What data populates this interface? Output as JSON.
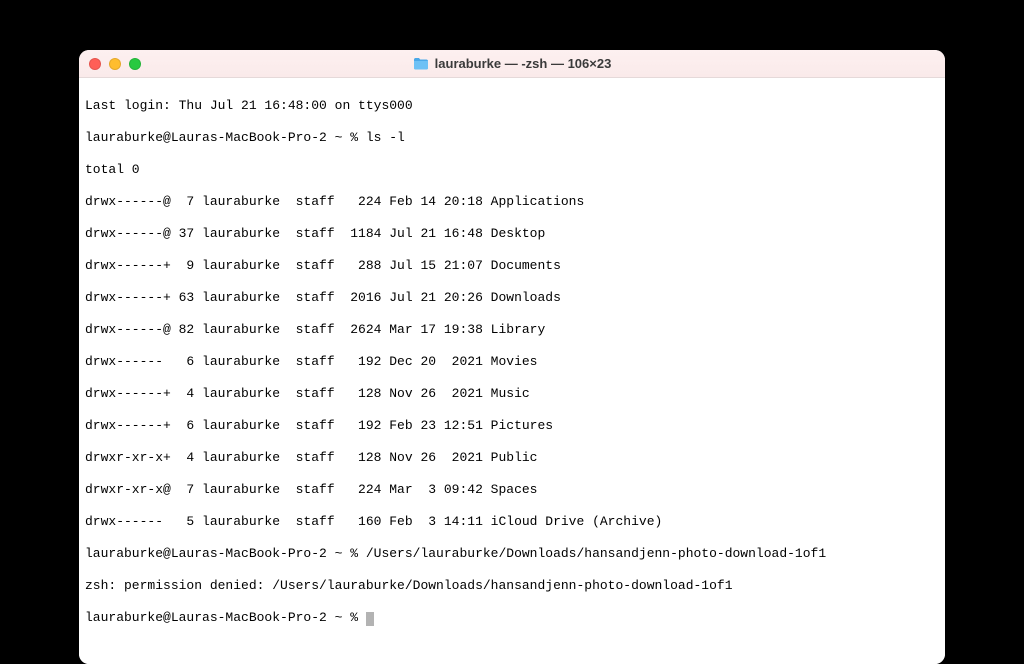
{
  "window": {
    "title": "lauraburke — -zsh — 106×23"
  },
  "terminal": {
    "lastLogin": "Last login: Thu Jul 21 16:48:00 on ttys000",
    "prompt1": "lauraburke@Lauras-MacBook-Pro-2 ~ % ls -l",
    "total": "total 0",
    "rows": [
      "drwx------@  7 lauraburke  staff   224 Feb 14 20:18 Applications",
      "drwx------@ 37 lauraburke  staff  1184 Jul 21 16:48 Desktop",
      "drwx------+  9 lauraburke  staff   288 Jul 15 21:07 Documents",
      "drwx------+ 63 lauraburke  staff  2016 Jul 21 20:26 Downloads",
      "drwx------@ 82 lauraburke  staff  2624 Mar 17 19:38 Library",
      "drwx------   6 lauraburke  staff   192 Dec 20  2021 Movies",
      "drwx------+  4 lauraburke  staff   128 Nov 26  2021 Music",
      "drwx------+  6 lauraburke  staff   192 Feb 23 12:51 Pictures",
      "drwxr-xr-x+  4 lauraburke  staff   128 Nov 26  2021 Public",
      "drwxr-xr-x@  7 lauraburke  staff   224 Mar  3 09:42 Spaces",
      "drwx------   5 lauraburke  staff   160 Feb  3 14:11 iCloud Drive (Archive)"
    ],
    "prompt2": "lauraburke@Lauras-MacBook-Pro-2 ~ % /Users/lauraburke/Downloads/hansandjenn-photo-download-1of1",
    "error": "zsh: permission denied: /Users/lauraburke/Downloads/hansandjenn-photo-download-1of1",
    "prompt3": "lauraburke@Lauras-MacBook-Pro-2 ~ % "
  }
}
